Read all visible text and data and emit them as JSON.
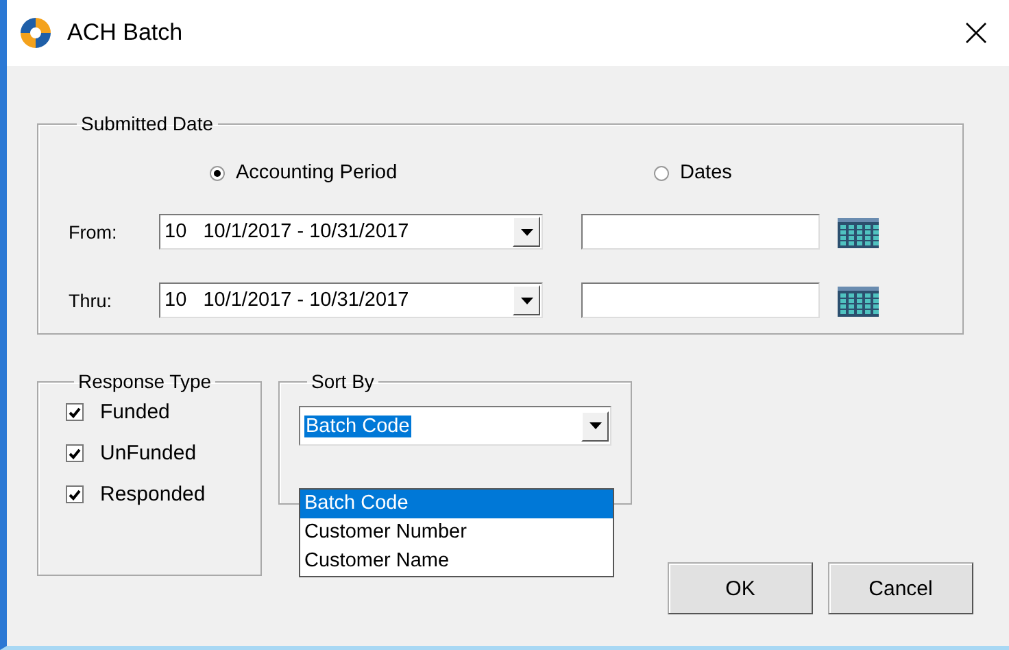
{
  "window": {
    "title": "ACH Batch"
  },
  "submitted_date": {
    "label": "Submitted Date",
    "modes": [
      {
        "label": "Accounting Period",
        "selected": true
      },
      {
        "label": "Dates",
        "selected": false
      }
    ],
    "rows": [
      {
        "label": "From:",
        "period": "10   10/1/2017 - 10/31/2017"
      },
      {
        "label": "Thru:",
        "period": "10   10/1/2017 - 10/31/2017"
      }
    ]
  },
  "response_type": {
    "label": "Response Type",
    "options": [
      {
        "label": "Funded",
        "checked": true
      },
      {
        "label": "UnFunded",
        "checked": true
      },
      {
        "label": "Responded",
        "checked": true
      }
    ]
  },
  "sort_by": {
    "label": "Sort By",
    "value": "Batch Code",
    "expanded": true,
    "options": [
      {
        "label": "Batch Code",
        "selected": true
      },
      {
        "label": "Customer Number",
        "selected": false
      },
      {
        "label": "Customer Name",
        "selected": false
      }
    ]
  },
  "buttons": [
    "OK",
    "Cancel"
  ]
}
